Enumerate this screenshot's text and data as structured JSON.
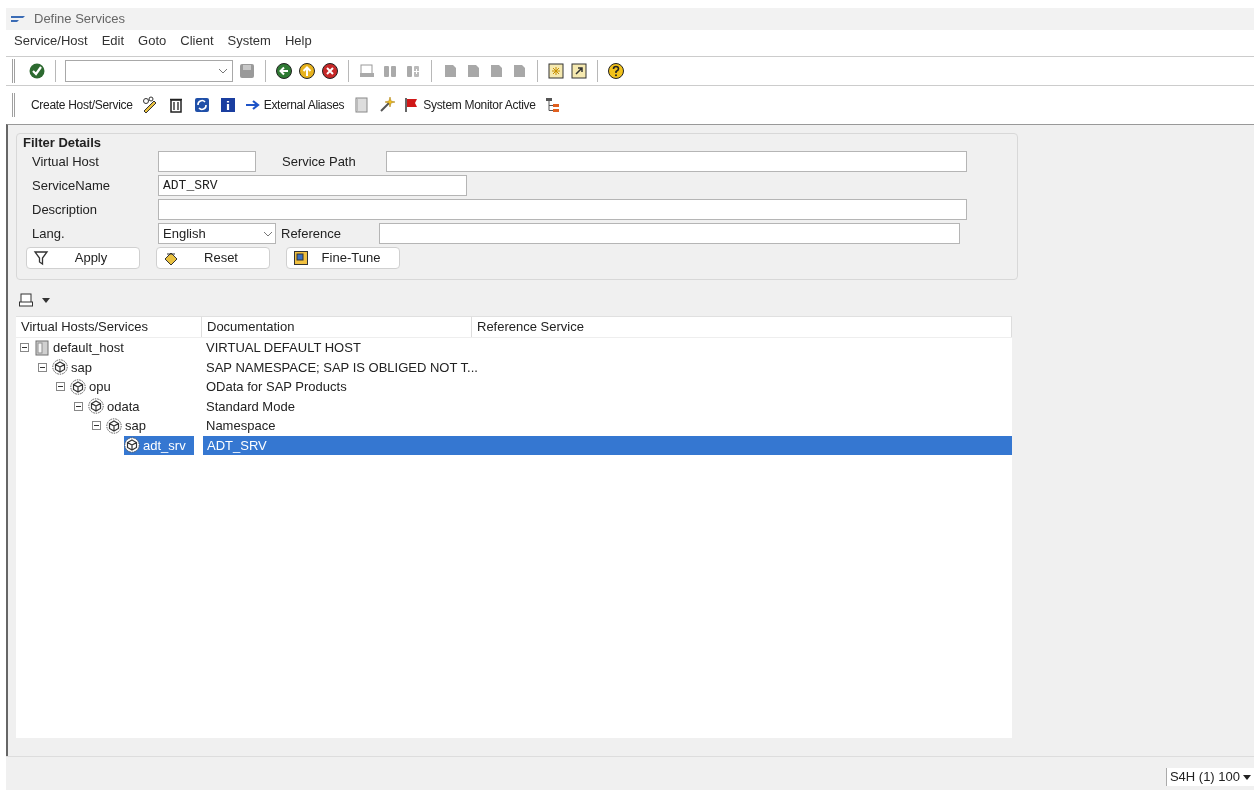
{
  "window": {
    "title": "Define Services"
  },
  "menu": [
    "Service/Host",
    "Edit",
    "Goto",
    "Client",
    "System",
    "Help"
  ],
  "app_toolbar": {
    "create_label": "Create Host/Service",
    "aliases_label": "External Aliases",
    "monitor_label": "System Monitor Active"
  },
  "filter": {
    "title": "Filter Details",
    "virtual_host": {
      "label": "Virtual Host"
    },
    "service_path": {
      "label": "Service Path"
    },
    "service_name": {
      "label": "ServiceName",
      "value": "ADT_SRV"
    },
    "description": {
      "label": "Description"
    },
    "lang": {
      "label": "Lang.",
      "value": "English"
    },
    "reference": {
      "label": "Reference"
    },
    "buttons": [
      "Apply",
      "Reset",
      "Fine-Tune"
    ]
  },
  "tree": {
    "columns": [
      "Virtual Hosts/Services",
      "Documentation",
      "Reference Service"
    ],
    "rows": [
      {
        "kind": "host",
        "name": "default_host",
        "documentation": "VIRTUAL DEFAULT HOST",
        "expanded": true,
        "selected": false,
        "children": [
          {
            "kind": "service",
            "name": "sap",
            "documentation": "SAP NAMESPACE; SAP IS OBLIGED NOT T...",
            "expanded": true,
            "selected": false,
            "children": [
              {
                "kind": "service",
                "name": "opu",
                "documentation": "OData for SAP Products",
                "expanded": true,
                "selected": false,
                "children": [
                  {
                    "kind": "service",
                    "name": "odata",
                    "documentation": "Standard Mode",
                    "expanded": true,
                    "selected": false,
                    "children": [
                      {
                        "kind": "service",
                        "name": "sap",
                        "documentation": "Namespace",
                        "expanded": true,
                        "selected": false,
                        "children": [
                          {
                            "kind": "service",
                            "name": "adt_srv",
                            "documentation": "ADT_SRV",
                            "selected": true
                          }
                        ]
                      }
                    ]
                  }
                ]
              }
            ]
          }
        ]
      }
    ]
  },
  "status_bar": {
    "system": "S4H (1) 100"
  }
}
